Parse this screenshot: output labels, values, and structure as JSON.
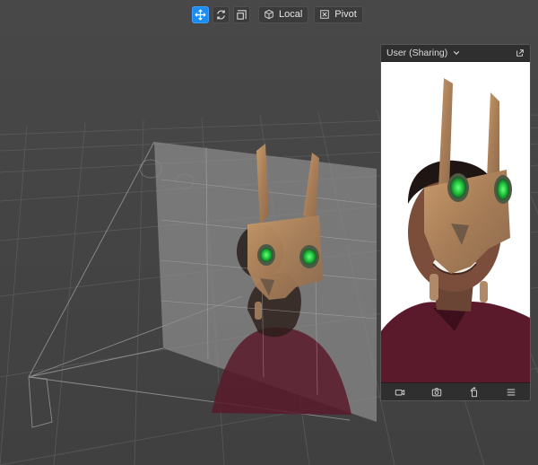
{
  "toolbar": {
    "tools": [
      {
        "name": "move-tool",
        "icon": "move-arrows-icon",
        "active": true
      },
      {
        "name": "rotate-tool",
        "icon": "rotate-icon",
        "active": false
      },
      {
        "name": "scale-tool",
        "icon": "scale-icon",
        "active": false
      }
    ],
    "space_label": "Local",
    "pivot_label": "Pivot"
  },
  "preview_panel": {
    "title": "User (Sharing)",
    "footer_icons": [
      "video-camera-icon",
      "camera-switch-icon",
      "rotate-device-icon",
      "menu-icon"
    ]
  },
  "colors": {
    "accent": "#1d8cf0",
    "viewport_bg": "#454545",
    "panel_bg": "#2b2b2b",
    "mask_green": "#27d34a",
    "mask_rust": "#b58a5c",
    "shirt": "#5a1a2c"
  }
}
